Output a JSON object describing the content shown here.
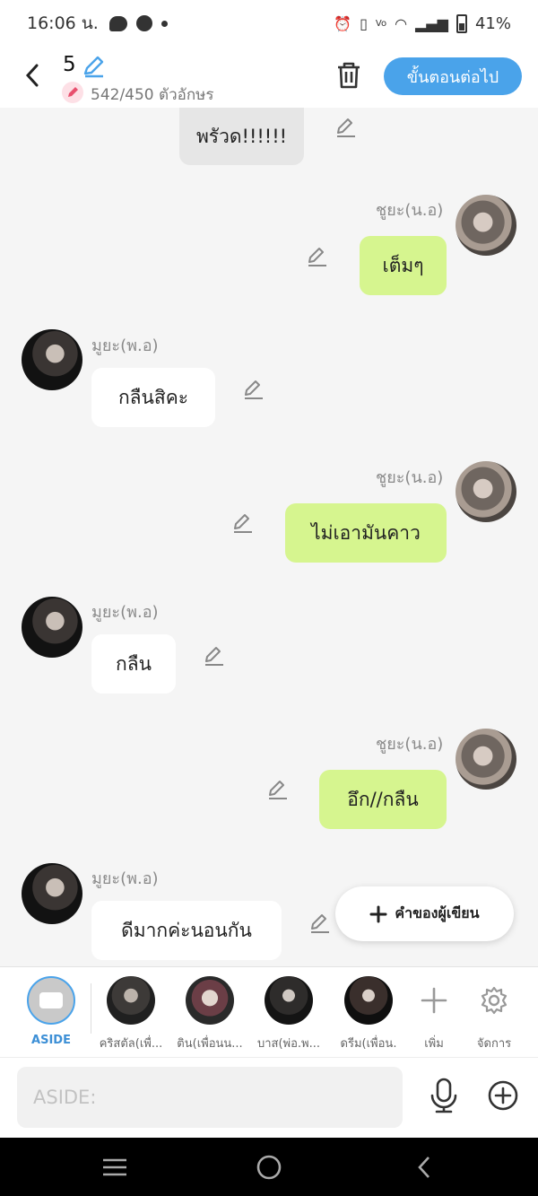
{
  "status_bar": {
    "time": "16:06 น.",
    "battery": "41%"
  },
  "header": {
    "chapter": "5",
    "char_count": "542/450 ตัวอักษร",
    "next_label": "ขั้นตอนต่อไป"
  },
  "messages": [
    {
      "speaker": "",
      "text": "พรัวด!!!!!!",
      "side": "aside"
    },
    {
      "speaker": "ชูยะ(น.อ)",
      "text": "เต็มๆ",
      "side": "right"
    },
    {
      "speaker": "มูยะ(พ.อ)",
      "text": "กลืนสิคะ",
      "side": "left"
    },
    {
      "speaker": "ชูยะ(น.อ)",
      "text": "ไม่เอามันคาว",
      "side": "right"
    },
    {
      "speaker": "มูยะ(พ.อ)",
      "text": "กลืน",
      "side": "left"
    },
    {
      "speaker": "ชูยะ(น.อ)",
      "text": "อึก//กลืน",
      "side": "right"
    },
    {
      "speaker": "มูยะ(พ.อ)",
      "text": "ดีมากค่ะนอนกัน",
      "side": "left"
    }
  ],
  "writer_button": "คำของผู้เขียน",
  "characters": [
    {
      "label": "ASIDE"
    },
    {
      "label": "คริสตัล(เพื่..."
    },
    {
      "label": "ติน(เพื่อนน..."
    },
    {
      "label": "บาส(พ่อ.พ..."
    },
    {
      "label": "ดรีม(เพื่อน."
    }
  ],
  "tools": {
    "add_label": "เพิ่ม",
    "manage_label": "จัดการ"
  },
  "input": {
    "placeholder": "ASIDE:"
  },
  "icons": [
    "back-icon",
    "edit-icon",
    "trash-icon",
    "mic-icon",
    "plus-circle-icon",
    "gear-icon",
    "menu-icon",
    "home-icon",
    "nav-back-icon"
  ]
}
